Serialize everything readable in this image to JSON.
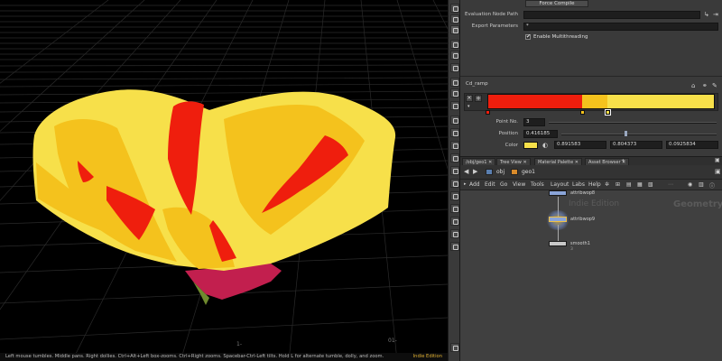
{
  "viewport": {
    "status": "Left mouse tumbles. Middle pans. Right dollies. Ctrl+Alt+Left box-zooms. Ctrl+Right zooms. Spacebar-Ctrl-Left tilts. Hold L for alternate tumble, dolly, and zoom.",
    "edition": "Indie Edition",
    "axis_labels": [
      "1-",
      "01-"
    ],
    "colors": {
      "yellow": "#f7e04a",
      "gold": "#f4c21d",
      "red": "#ef1e0d",
      "magenta": "#c21f4e",
      "green": "#6f8a2e"
    }
  },
  "params": {
    "force_compile": "Force Compile",
    "eval_node_path_label": "Evaluation Node Path",
    "export_params_label": "Export Parameters",
    "export_params_value": "*",
    "multithread_label": "Enable Multithreading",
    "ramp_name": "Cd_ramp",
    "point_no_label": "Point No.",
    "point_no_value": "3",
    "position_label": "Position",
    "position_value": "0.416185",
    "position_fraction": 0.416185,
    "color_label": "Color",
    "color_values": [
      "0.891583",
      "0.804373",
      "0.0925834"
    ],
    "ramp_stops": [
      {
        "pos": 0.0,
        "color": "#ef1e0d"
      },
      {
        "pos": 0.416185,
        "color": "#f4c21d"
      },
      {
        "pos": 0.53,
        "color": "#f7e04a"
      }
    ]
  },
  "network": {
    "tabs": [
      "/obj/geo1",
      "Tree View",
      "Material Palette",
      "Asset Browser"
    ],
    "path_obj": "obj",
    "path_geo": "geo1",
    "menu": [
      "Add",
      "Edit",
      "Go",
      "View",
      "Tools",
      "Layout",
      "Labs",
      "Help"
    ],
    "watermark_edition": "Indie Edition",
    "watermark_context": "Geometry",
    "nodes": [
      {
        "name": "attribwop8",
        "sub": "",
        "color": "#8aa4d8"
      },
      {
        "name": "attribwop9",
        "sub": "",
        "color": "#8aa4d8"
      },
      {
        "name": "smooth1",
        "sub": "3",
        "color": "#c8c8c8"
      }
    ]
  }
}
